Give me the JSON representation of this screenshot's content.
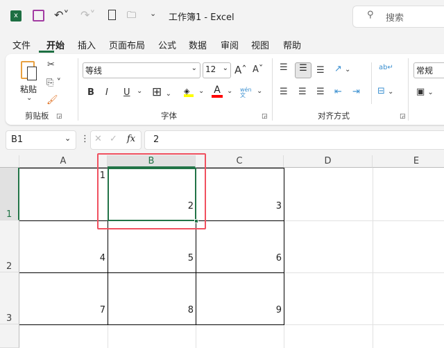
{
  "title": {
    "text": "工作簿1  -  Excel",
    "search_placeholder": "搜索"
  },
  "menu": [
    "文件",
    "开始",
    "插入",
    "页面布局",
    "公式",
    "数据",
    "审阅",
    "视图",
    "帮助"
  ],
  "ribbon": {
    "clipboard": {
      "label": "剪贴板",
      "paste": "粘贴"
    },
    "font": {
      "label": "字体",
      "font_name": "等线",
      "font_size": "12",
      "bold": "B",
      "italic": "I",
      "underline": "U",
      "font_color": "A",
      "phonetic": "wén 文",
      "fill_color": "#ffff00",
      "text_color": "#ff0000"
    },
    "alignment": {
      "label": "对齐方式"
    },
    "number": {
      "format": "常规"
    }
  },
  "formula_bar": {
    "name_box": "B1",
    "fx": "fx",
    "value": "2"
  },
  "sheet": {
    "columns": [
      "A",
      "B",
      "C",
      "D",
      "E"
    ],
    "rows": [
      "1",
      "2",
      "3"
    ],
    "cells": {
      "A1": "1",
      "B1": "2",
      "C1": "3",
      "A2": "4",
      "B2": "5",
      "C2": "6",
      "A3": "7",
      "B3": "8",
      "C3": "9"
    },
    "selected": "B1",
    "accent": "#217346",
    "highlight": "#f0505f"
  }
}
